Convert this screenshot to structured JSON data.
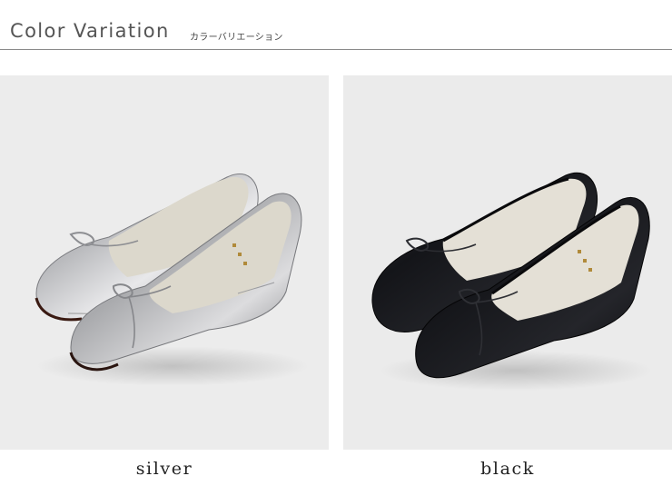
{
  "header": {
    "title": "Color Variation",
    "subtitle": "カラーバリエーション"
  },
  "variants": [
    {
      "label": "silver",
      "upper_color": "#c9cacc",
      "lining_color": "#dcd8cc"
    },
    {
      "label": "black",
      "upper_color": "#16171b",
      "lining_color": "#e4e0d6"
    }
  ],
  "colors": {
    "photo_background": "#ececec",
    "rule": "#8a8a8a",
    "title_text": "#555555"
  }
}
